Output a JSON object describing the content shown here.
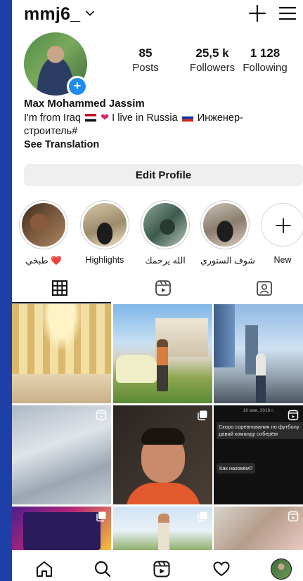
{
  "header": {
    "username": "mmj6_"
  },
  "profile": {
    "stats": [
      {
        "value": "85",
        "label": "Posts"
      },
      {
        "value": "25,5 k",
        "label": "Followers"
      },
      {
        "value": "1 128",
        "label": "Following"
      }
    ],
    "full_name": "Max Mohammed Jassim",
    "bio_line1_a": "I'm from Iraq",
    "bio_line1_b": "I live in Russia",
    "bio_line1_c": "Инженер-",
    "bio_line2": "строитель#",
    "see_translation": "See Translation",
    "edit_profile": "Edit Profile"
  },
  "highlights": [
    {
      "label": "طبخي ❤️"
    },
    {
      "label": "Highlights"
    },
    {
      "label": "الله يرحمك"
    },
    {
      "label": "شوف الستوري"
    },
    {
      "label": "New"
    }
  ],
  "posts": {
    "story_text_date": "19 мая, 2018 г.",
    "story_text_q1": "Скоро соревнования по футболу давай команду соберём",
    "story_text_q2": "Как назовём?"
  },
  "colors": {
    "accent": "#1f8cf0",
    "background": "#1f3fa8",
    "button": "#efefef"
  }
}
